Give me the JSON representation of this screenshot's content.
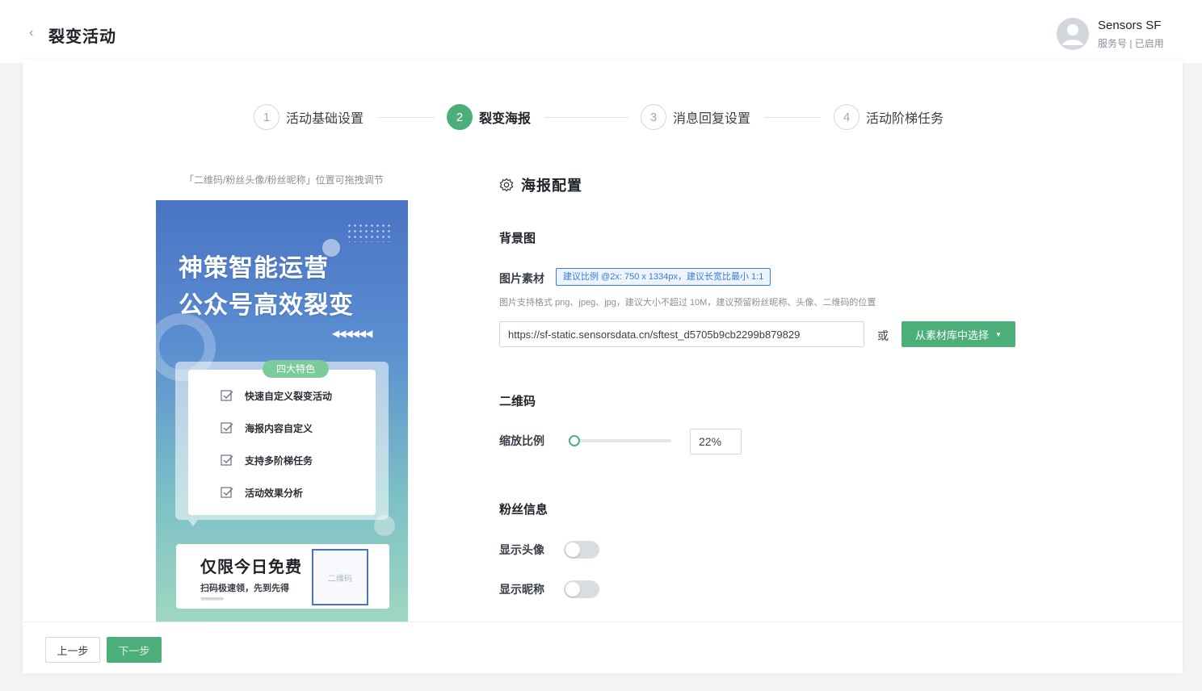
{
  "header": {
    "back_icon": "chevron-left-icon",
    "title": "裂变活动",
    "user": {
      "name": "Sensors SF",
      "subtitle": "服务号 | 已启用",
      "avatar_icon": "user-avatar-icon"
    }
  },
  "steps": [
    {
      "number": "1",
      "label": "活动基础设置",
      "active": false
    },
    {
      "number": "2",
      "label": "裂变海报",
      "active": true
    },
    {
      "number": "3",
      "label": "消息回复设置",
      "active": false
    },
    {
      "number": "4",
      "label": "活动阶梯任务",
      "active": false
    }
  ],
  "poster_panel": {
    "hint": "「二维码/粉丝头像/粉丝昵称」位置可拖拽调节",
    "poster": {
      "title_line1": "神策智能运营",
      "title_line2": "公众号高效裂变",
      "arrows": "◀◀◀◀◀◀",
      "features_badge": "四大特色",
      "features": [
        "快速自定义裂变活动",
        "海报内容自定义",
        "支持多阶梯任务",
        "活动效果分析"
      ],
      "free_title": "仅限今日免费",
      "free_subtitle": "扫码极速领，先到先得",
      "free_arrows": "››››››››››››››",
      "qr_placeholder": "二维码"
    }
  },
  "config": {
    "section_title": "海报配置",
    "section_icon": "gear-icon",
    "background": {
      "heading": "背景图",
      "material_label": "图片素材",
      "ratio_tip": "建议比例 @2x: 750 x 1334px，建议长宽比最小 1:1",
      "help_text": "图片支持格式 png、jpeg、jpg，建议大小不超过 10M，建议预留粉丝昵称、头像、二维码的位置",
      "url_value": "https://sf-static.sensorsdata.cn/sftest_d5705b9cb2299b879829",
      "or_text": "或",
      "library_button": "从素材库中选择",
      "library_caret": "▼"
    },
    "qrcode": {
      "heading": "二维码",
      "scale_label": "缩放比例",
      "scale_value": "22%",
      "scale_fraction": 0.0
    },
    "fan_info": {
      "heading": "粉丝信息",
      "show_avatar_label": "显示头像",
      "show_avatar": false,
      "show_nickname_label": "显示昵称",
      "show_nickname": false
    }
  },
  "footer": {
    "prev_label": "上一步",
    "next_label": "下一步"
  },
  "colors": {
    "accent": "#4caf7a",
    "link_blue": "#3b7bd6"
  }
}
